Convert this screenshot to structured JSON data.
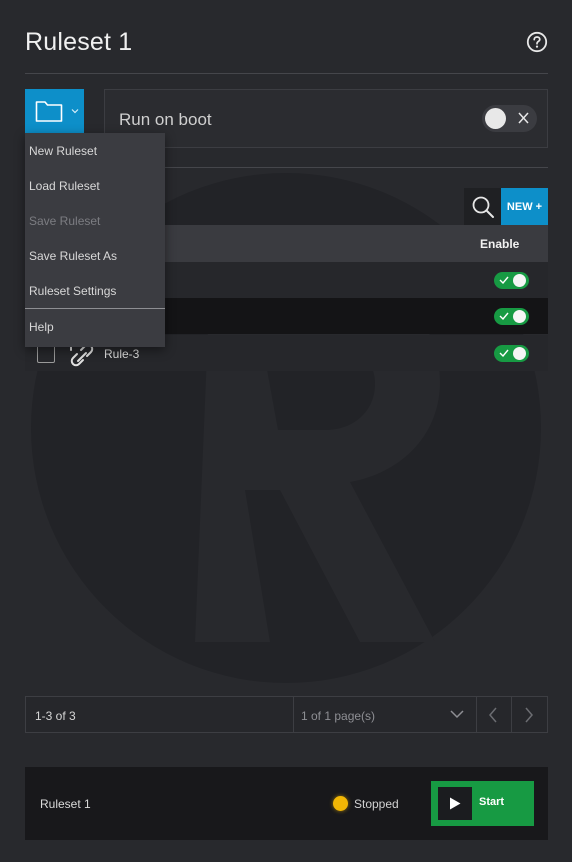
{
  "header": {
    "title": "Ruleset 1",
    "help_icon": "help-circle-icon"
  },
  "boot": {
    "label": "Run on boot",
    "enabled": false
  },
  "toolbar": {
    "new_label": "NEW +",
    "search_icon": "search-icon",
    "folder_icon": "folder-icon"
  },
  "menu": {
    "items": [
      {
        "label": "New Ruleset",
        "disabled": false
      },
      {
        "label": "Load Ruleset",
        "disabled": false
      },
      {
        "label": "Save Ruleset",
        "disabled": true
      },
      {
        "label": "Save Ruleset As",
        "disabled": false
      },
      {
        "label": "Ruleset Settings",
        "disabled": false
      },
      {
        "label": "Help",
        "disabled": false
      }
    ]
  },
  "table": {
    "columns": {
      "enable": "Enable"
    },
    "rows": [
      {
        "name": "",
        "enabled": true
      },
      {
        "name": "",
        "enabled": true
      },
      {
        "name": "Rule-3",
        "enabled": true
      }
    ]
  },
  "pagination": {
    "count": "1-3 of 3",
    "pages": "1 of 1 page(s)"
  },
  "footer": {
    "ruleset_name": "Ruleset 1",
    "status": "Stopped",
    "start_label": "Start"
  },
  "colors": {
    "accent": "#0d8fc9",
    "success": "#179a43",
    "status_stopped": "#f2b705"
  }
}
